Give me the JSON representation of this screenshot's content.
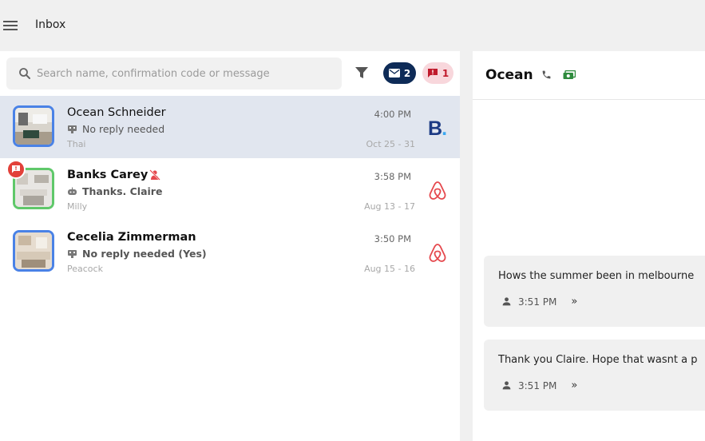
{
  "header": {
    "title": "Inbox",
    "menu_icon": "hamburger-menu-icon"
  },
  "search": {
    "placeholder": "Search name, confirmation code or message",
    "value": ""
  },
  "badges": {
    "mail": {
      "icon": "mail-icon",
      "count": "2",
      "color": "#0e2b57"
    },
    "alert": {
      "icon": "alert-message-icon",
      "count": "1",
      "color": "#f8d7dc"
    }
  },
  "conversations": [
    {
      "name": "Ocean Schneider",
      "status_icon": "robot-icon",
      "message": "No reply needed",
      "subtitle": "Thai",
      "time": "4:00 PM",
      "dates": "Oct 25 - 31",
      "channel": "booking-com",
      "channel_label": "B",
      "selected": true,
      "unread": false,
      "border": "blue"
    },
    {
      "name": "Banks Carey",
      "status_icon": "robot-icon",
      "message": "Thanks. Claire",
      "subtitle": "Milly",
      "time": "3:58 PM",
      "dates": "Aug 13 - 17",
      "channel": "airbnb",
      "selected": false,
      "unread": true,
      "alert": true,
      "border": "green"
    },
    {
      "name": "Cecelia Zimmerman",
      "status_icon": "robot-icon",
      "message": "No reply needed (Yes)",
      "subtitle": "Peacock",
      "time": "3:50 PM",
      "dates": "Aug 15 - 16",
      "channel": "airbnb",
      "selected": false,
      "unread": true,
      "border": "blue"
    }
  ],
  "conversation": {
    "name": "Ocean",
    "messages": [
      {
        "text": "Hows the summer been in melbourne",
        "time": "3:51 PM"
      },
      {
        "text": "Thank you Claire. Hope that wasnt a p",
        "time": "3:51 PM"
      }
    ]
  },
  "colors": {
    "accent_blue": "#4a82e6",
    "accent_green": "#5fc86a",
    "airbnb": "#e5484d",
    "booking": "#1c3a84",
    "alert": "#e2413a"
  }
}
